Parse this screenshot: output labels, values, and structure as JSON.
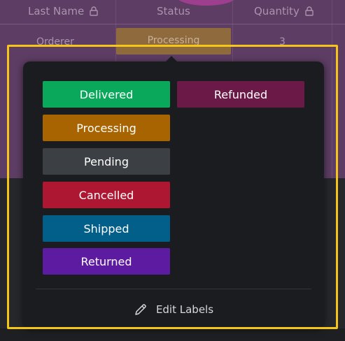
{
  "table": {
    "headers": [
      "Last Name",
      "Status",
      "Quantity"
    ],
    "row": {
      "last_name": "Orderer",
      "status": "Processing",
      "quantity": "3"
    }
  },
  "popover": {
    "labels": [
      {
        "text": "Delivered",
        "color": "#0aa85a"
      },
      {
        "text": "Refunded",
        "color": "#6b1a47"
      },
      {
        "text": "Processing",
        "color": "#a86400"
      },
      {
        "text": "Pending",
        "color": "#3c4045"
      },
      {
        "text": "Cancelled",
        "color": "#ad1732"
      },
      {
        "text": "Shipped",
        "color": "#015f8a"
      },
      {
        "text": "Returned",
        "color": "#5c1ba0"
      }
    ],
    "edit_labels": "Edit Labels"
  },
  "colors": {
    "highlight": "#f5c518",
    "popover_bg": "#1b1c1f"
  }
}
